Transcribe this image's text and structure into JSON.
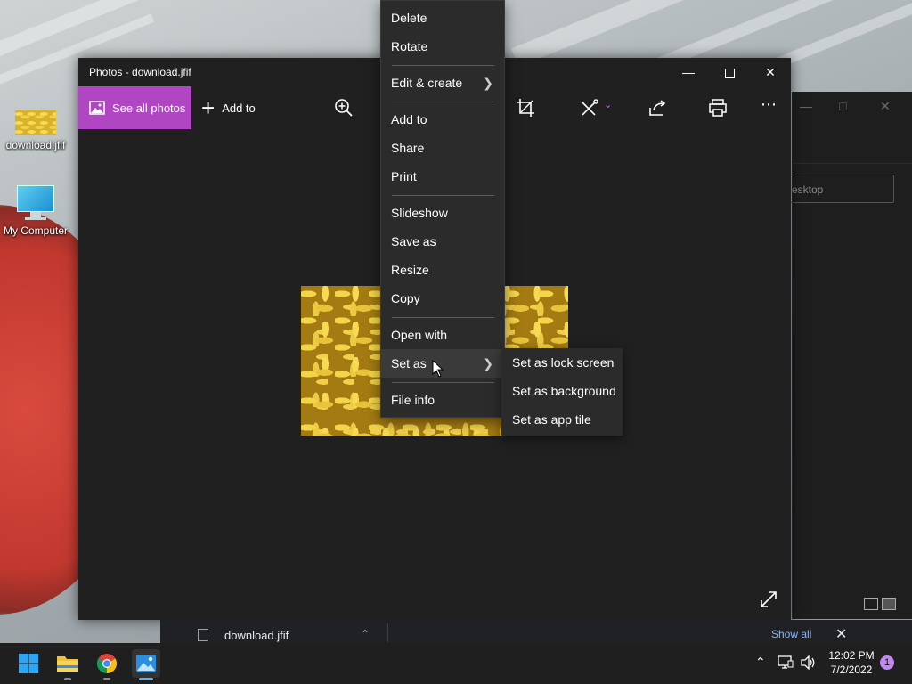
{
  "desktop": {
    "icons": [
      {
        "label": "download.jfif"
      },
      {
        "label": "My Computer"
      }
    ]
  },
  "background_window": {
    "search_placeholder": "esktop"
  },
  "photos": {
    "title": "Photos - download.jfif",
    "toolbar": {
      "see_all_label": "See all photos",
      "add_to_label": "Add to"
    }
  },
  "context_menu": {
    "items": [
      {
        "label": "Delete"
      },
      {
        "label": "Rotate"
      },
      {
        "label": "Edit & create"
      },
      {
        "label": "Add to"
      },
      {
        "label": "Share"
      },
      {
        "label": "Print"
      },
      {
        "label": "Slideshow"
      },
      {
        "label": "Save as"
      },
      {
        "label": "Resize"
      },
      {
        "label": "Copy"
      },
      {
        "label": "Open with"
      },
      {
        "label": "Set as"
      },
      {
        "label": "File info"
      }
    ],
    "submenu": [
      {
        "label": "Set as lock screen"
      },
      {
        "label": "Set as background"
      },
      {
        "label": "Set as app tile"
      }
    ]
  },
  "downloads": {
    "file_name": "download.jfif",
    "show_all": "Show all"
  },
  "taskbar": {
    "time": "12:02 PM",
    "date": "7/2/2022",
    "notification_count": "1"
  },
  "colors": {
    "accent": "#b146c2",
    "window_bg": "#202020",
    "menu_bg": "#2b2b2b"
  }
}
